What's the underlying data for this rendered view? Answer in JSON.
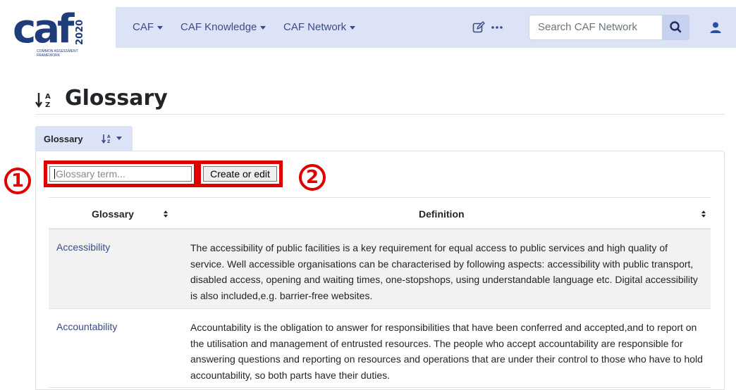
{
  "logo": {
    "main": "caf",
    "year": "2020",
    "subtitle": "COMMON ASSESSMENT FRAMEWORK"
  },
  "navbar": {
    "menus": [
      "CAF",
      "CAF Knowledge",
      "CAF Network"
    ],
    "icons": [
      "edit-icon",
      "more-icon",
      "search-icon",
      "user-icon"
    ],
    "search_placeholder": "Search CAF Network"
  },
  "page": {
    "title": "Glossary",
    "title_icon": "sort-alpha-icon"
  },
  "tab": {
    "label": "Glossary"
  },
  "form": {
    "term_placeholder": "Glossary term...",
    "button_label": "Create or edit"
  },
  "annotations": [
    "1",
    "2"
  ],
  "table": {
    "columns": [
      "Glossary",
      "Definition"
    ],
    "rows": [
      {
        "term": "Accessibility",
        "definition": "The accessibility of public facilities is a key requirement for equal access to public services and high quality of service. Well accessible organisations can be characterised by following aspects: accessibility with public transport, disabled access, opening and waiting times, one-stopshops, using understandable language etc. Digital accessibility is also included,e.g. barrier-free websites."
      },
      {
        "term": "Accountability",
        "definition": "Accountability is the obligation to answer for responsibilities that have been conferred and accepted,and to report on the utilisation and management of entrusted resources. The people who accept accountability are responsible for answering questions and reporting on resources and operations that are under their control to those who have to hold accountability, so both parts have their duties."
      }
    ]
  },
  "colors": {
    "nav_bg": "#dde3f6",
    "link": "#3b4b8a",
    "highlight": "#e00000",
    "stripe": "#f2f2f2"
  }
}
